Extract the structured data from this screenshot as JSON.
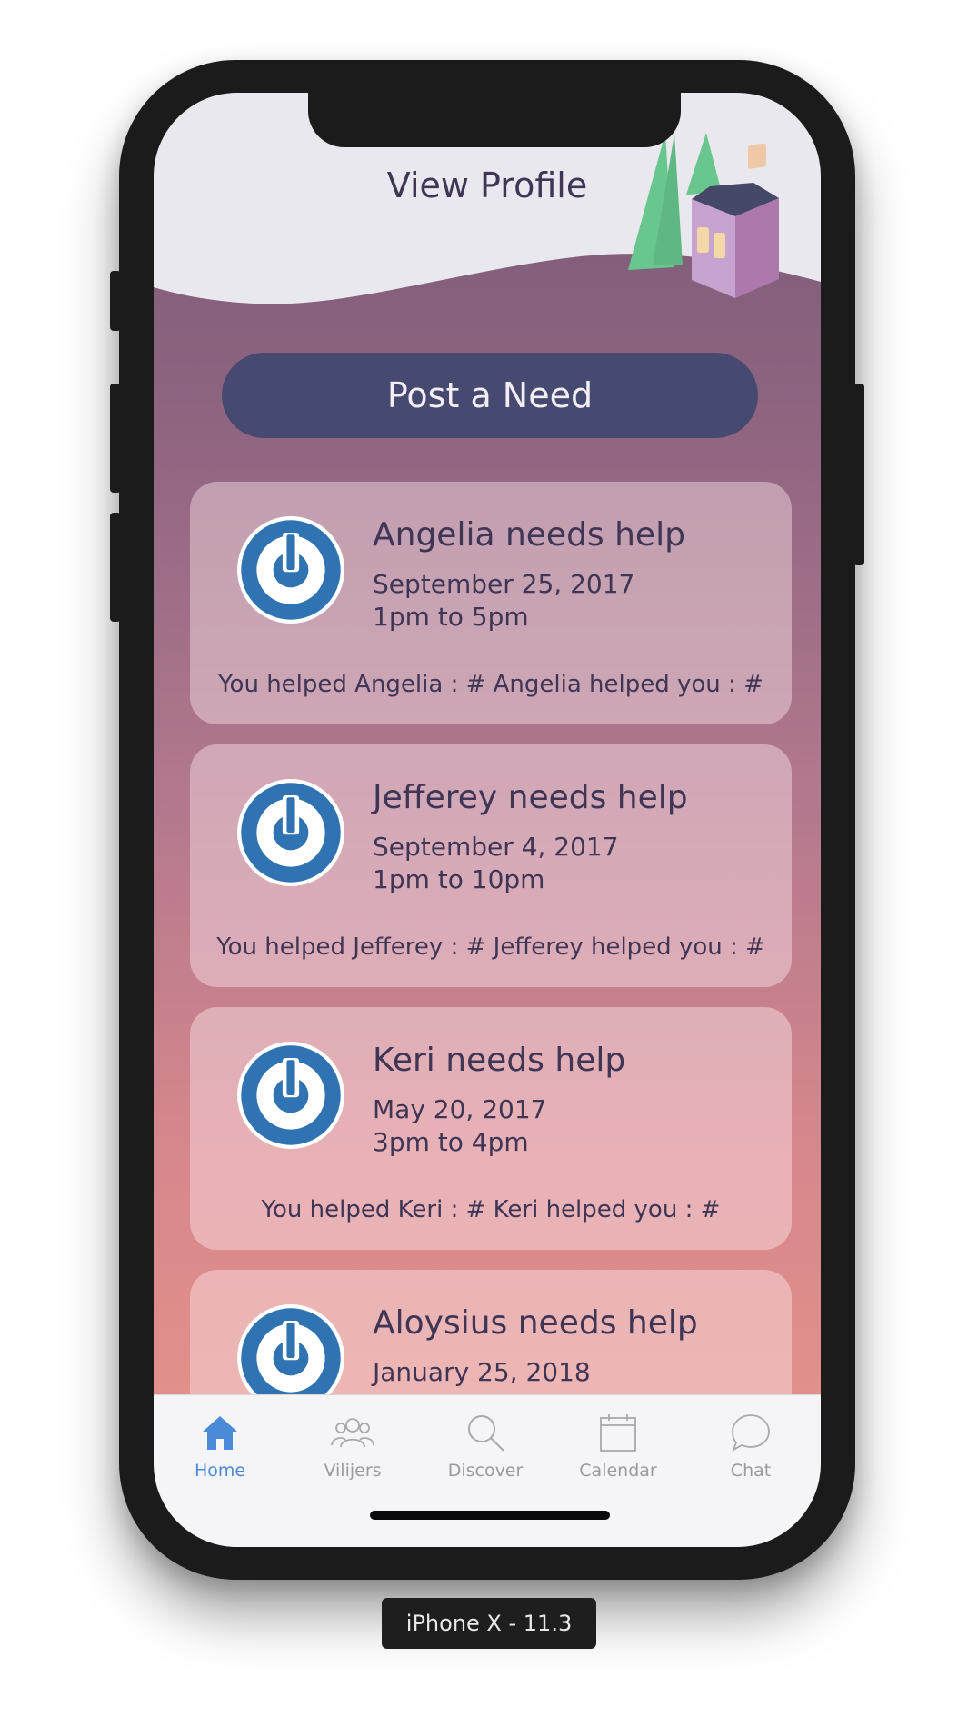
{
  "header": {
    "title": "View Profile"
  },
  "actions": {
    "post_need_label": "Post a Need"
  },
  "cards": [
    {
      "name_line": "Angelia needs help",
      "date": "September 25, 2017",
      "time": "1pm to 5pm",
      "helped_line": "You helped Angelia : #  Angelia helped you : #"
    },
    {
      "name_line": "Jefferey needs help",
      "date": "September 4, 2017",
      "time": "1pm to 10pm",
      "helped_line": "You helped Jefferey : #  Jefferey helped you : #"
    },
    {
      "name_line": "Keri needs help",
      "date": "May 20, 2017",
      "time": "3pm to 4pm",
      "helped_line": "You helped Keri : #  Keri helped you : #"
    },
    {
      "name_line": "Aloysius needs help",
      "date": "January 25, 2018",
      "time": "",
      "helped_line": ""
    }
  ],
  "tabbar": {
    "items": [
      {
        "label": "Home",
        "icon": "home-icon",
        "active": true
      },
      {
        "label": "Vilijers",
        "icon": "people-icon",
        "active": false
      },
      {
        "label": "Discover",
        "icon": "search-icon",
        "active": false
      },
      {
        "label": "Calendar",
        "icon": "calendar-icon",
        "active": false
      },
      {
        "label": "Chat",
        "icon": "chat-bubble-icon",
        "active": false
      }
    ]
  },
  "device": {
    "label": "iPhone X - 11.3"
  },
  "colors": {
    "accent": "#4a8ad6",
    "button": "#474a70",
    "text": "#3f3555",
    "avatar_blue": "#2f73b2"
  }
}
